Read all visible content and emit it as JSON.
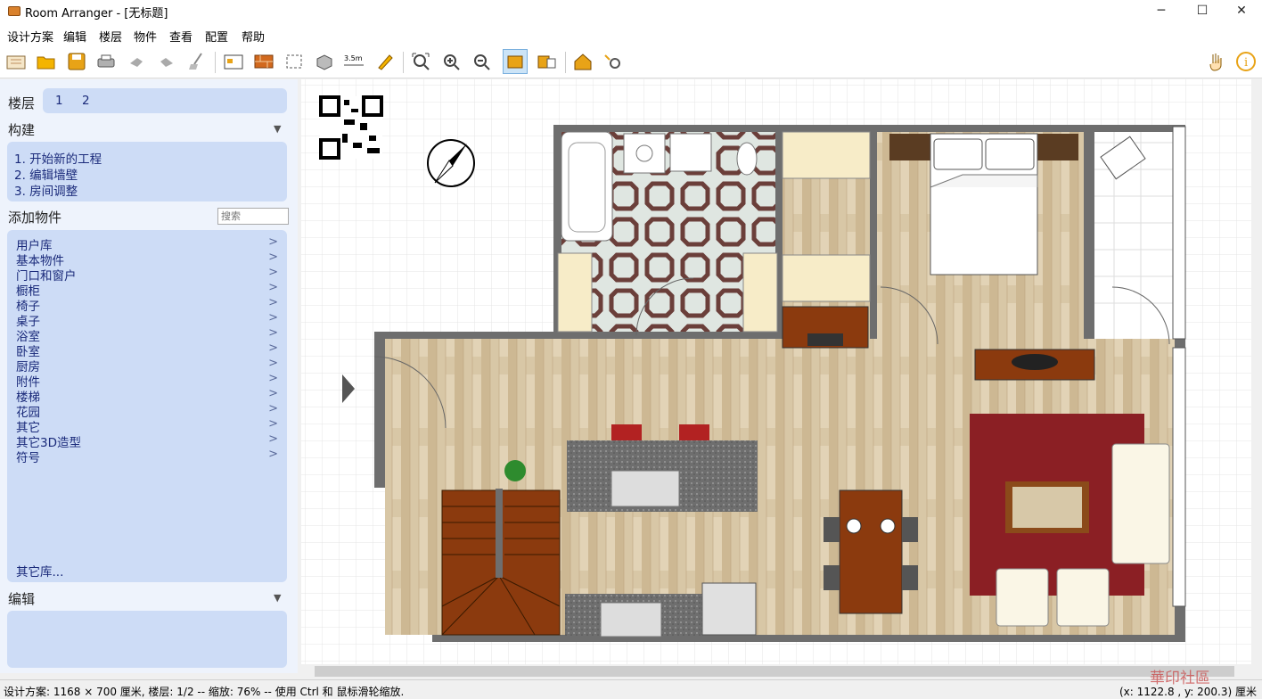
{
  "window": {
    "title": "Room Arranger - [无标题]",
    "minimize": "─",
    "maximize": "☐",
    "close": "✕"
  },
  "menu": [
    "设计方案",
    "编辑",
    "楼层",
    "物件",
    "查看",
    "配置",
    "帮助"
  ],
  "toolbar": {
    "measure_label": "3.5m"
  },
  "sidebar": {
    "floors_title": "楼层",
    "floors": [
      "1",
      "2"
    ],
    "build_title": "构建",
    "build_steps": [
      "1.  开始新的工程",
      "2.  编辑墙壁",
      "3.  房间调整"
    ],
    "add_title": "添加物件",
    "search_placeholder": "搜索",
    "categories": [
      "用户库",
      "基本物件",
      "门口和窗户",
      "橱柜",
      "椅子",
      "桌子",
      "浴室",
      "卧室",
      "厨房",
      "附件",
      "楼梯",
      "花园",
      "其它",
      "其它3D造型",
      "符号"
    ],
    "other_libs": "其它库...",
    "edit_title": "编辑",
    "collapse": "▼",
    "arrow": ">"
  },
  "status": {
    "left": "设计方案: 1168 × 700 厘米, 楼层: 1/2 -- 缩放: 76% -- 使用 Ctrl 和 鼠标滑轮缩放.",
    "right": "(x: 1122.8 , y: 200.3) 厘米"
  },
  "watermark": "華印社區",
  "colors": {
    "accent": "#cddcf6",
    "floor_wood": "#d8c7a6",
    "wall": "#6e6e6e",
    "rug": "#8b1f24",
    "furniture_wood": "#8b3a0e"
  }
}
